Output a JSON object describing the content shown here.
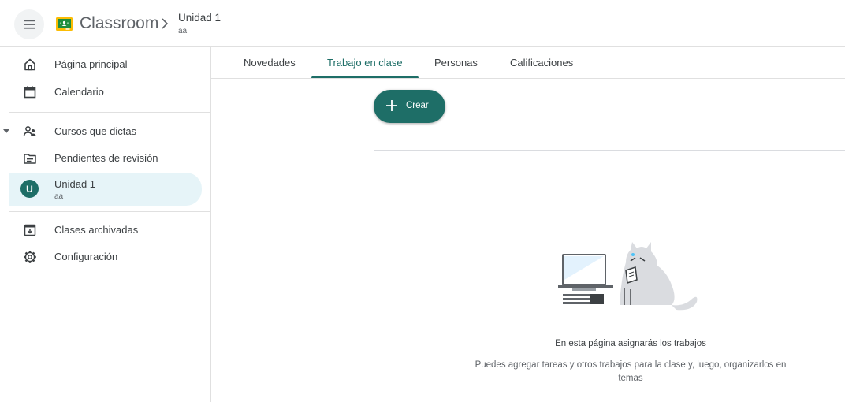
{
  "header": {
    "app_name": "Classroom",
    "breadcrumb": {
      "title": "Unidad 1",
      "subtitle": "aa"
    }
  },
  "sidebar": {
    "items": [
      {
        "label": "Página principal",
        "icon": "home-icon"
      },
      {
        "label": "Calendario",
        "icon": "calendar-icon"
      },
      {
        "label": "Cursos que dictas",
        "icon": "people-icon",
        "expanded": true
      },
      {
        "label": "Pendientes de revisión",
        "icon": "folder-icon"
      },
      {
        "label": "Unidad 1",
        "sublabel": "aa",
        "avatar": "U",
        "active": true
      },
      {
        "label": "Clases archivadas",
        "icon": "archive-icon"
      },
      {
        "label": "Configuración",
        "icon": "gear-icon"
      }
    ]
  },
  "tabs": [
    {
      "label": "Novedades"
    },
    {
      "label": "Trabajo en clase",
      "active": true
    },
    {
      "label": "Personas"
    },
    {
      "label": "Calificaciones"
    }
  ],
  "create_button": {
    "label": "Crear"
  },
  "empty_state": {
    "title": "En esta página asignarás los trabajos",
    "description": "Puedes agregar tareas y otros trabajos para la clase y, luego, organizarlos en temas"
  },
  "colors": {
    "accent": "#1e6e67",
    "active_bg": "#e6f4f8",
    "logo_green": "#1e8e3e",
    "logo_yellow": "#fbbc04"
  }
}
